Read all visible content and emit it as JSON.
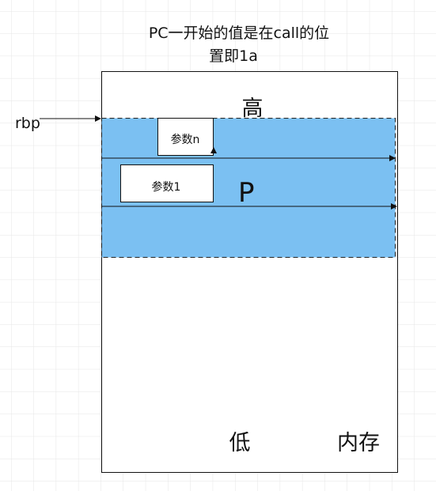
{
  "title_line1": "PC一开始的值是在call的位",
  "title_line2": "置即1a",
  "memory": {
    "high": "高",
    "low": "低",
    "label": "内存"
  },
  "rbp": "rbp",
  "frame": {
    "label": "P",
    "fill": "#7bc0f2"
  },
  "params": {
    "n": "参数n",
    "first": "参数1"
  }
}
